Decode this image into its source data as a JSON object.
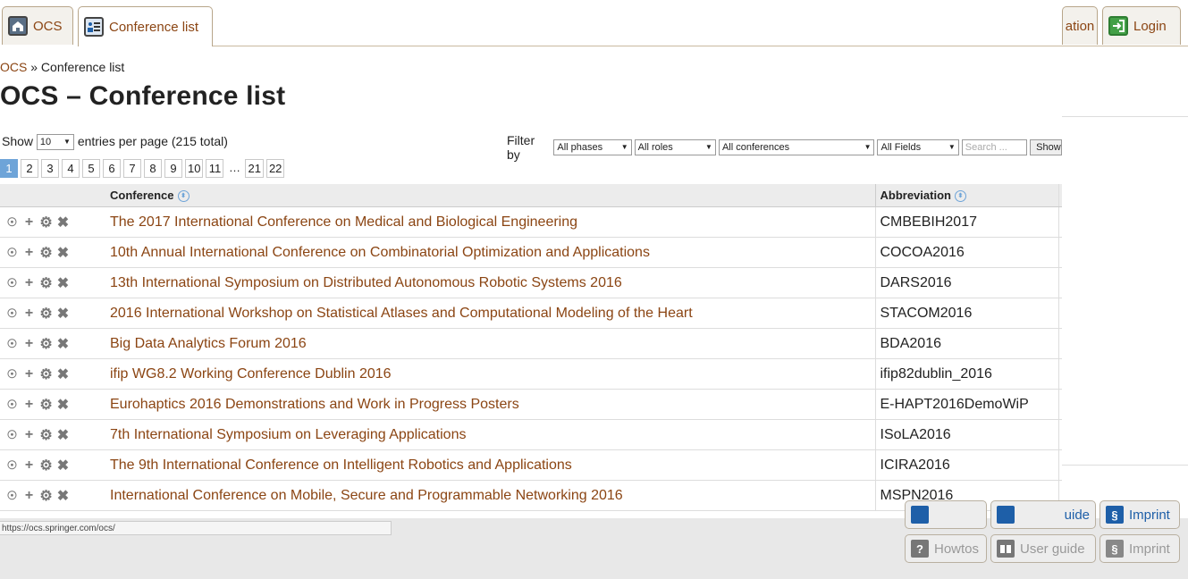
{
  "tabs": [
    {
      "label": "OCS",
      "icon": "home-icon"
    },
    {
      "label": "Conference list",
      "icon": "list-icon"
    }
  ],
  "right_tabs": {
    "partial_label": "ation",
    "login_label": "Login"
  },
  "breadcrumb": {
    "root": "OCS",
    "separator": "»",
    "current": "Conference list"
  },
  "page_title": "OCS – Conference list",
  "controls": {
    "show_label": "Show",
    "per_page_value": "10",
    "per_page_suffix": "entries per page (215 total)",
    "filter_label": "Filter by",
    "phases": "All phases",
    "roles": "All roles",
    "conferences": "All conferences",
    "fields": "All Fields",
    "search_placeholder": "Search ...",
    "show_button": "Show"
  },
  "pagination": [
    "1",
    "2",
    "3",
    "4",
    "5",
    "6",
    "7",
    "8",
    "9",
    "10",
    "11",
    "…",
    "21",
    "22"
  ],
  "pagination_current": "1",
  "table": {
    "headers": {
      "conference": "Conference",
      "abbreviation": "Abbreviation"
    },
    "rows": [
      {
        "conference": "The 2017 International Conference on Medical and Biological Engineering",
        "abbreviation": "CMBEBIH2017"
      },
      {
        "conference": "10th Annual International Conference on Combinatorial Optimization and Applications",
        "abbreviation": "COCOA2016"
      },
      {
        "conference": "13th International Symposium on Distributed Autonomous Robotic Systems 2016",
        "abbreviation": "DARS2016"
      },
      {
        "conference": "2016 International Workshop on Statistical Atlases and Computational Modeling of the Heart",
        "abbreviation": "STACOM2016"
      },
      {
        "conference": "Big Data Analytics Forum 2016",
        "abbreviation": "BDA2016"
      },
      {
        "conference": "ifip WG8.2 Working Conference Dublin 2016",
        "abbreviation": "ifip82dublin_2016"
      },
      {
        "conference": "Eurohaptics 2016 Demonstrations and Work in Progress Posters",
        "abbreviation": "E-HAPT2016DemoWiP"
      },
      {
        "conference": "7th International Symposium on Leveraging Applications",
        "abbreviation": "ISoLA2016"
      },
      {
        "conference": "The 9th International Conference on Intelligent Robotics and Applications",
        "abbreviation": "ICIRA2016"
      },
      {
        "conference": "International Conference on Mobile, Secure and Programmable Networking 2016",
        "abbreviation": "MSPN2016"
      }
    ]
  },
  "status_url": "https://ocs.springer.com/ocs/",
  "footer": {
    "top_partial_guide": "uide",
    "top_imprint": "Imprint",
    "howtos": "Howtos",
    "user_guide": "User guide",
    "imprint": "Imprint"
  },
  "colors": {
    "link": "#8b4513",
    "pager_active": "#6ea4d8",
    "accent_blue": "#1e5fa8"
  }
}
